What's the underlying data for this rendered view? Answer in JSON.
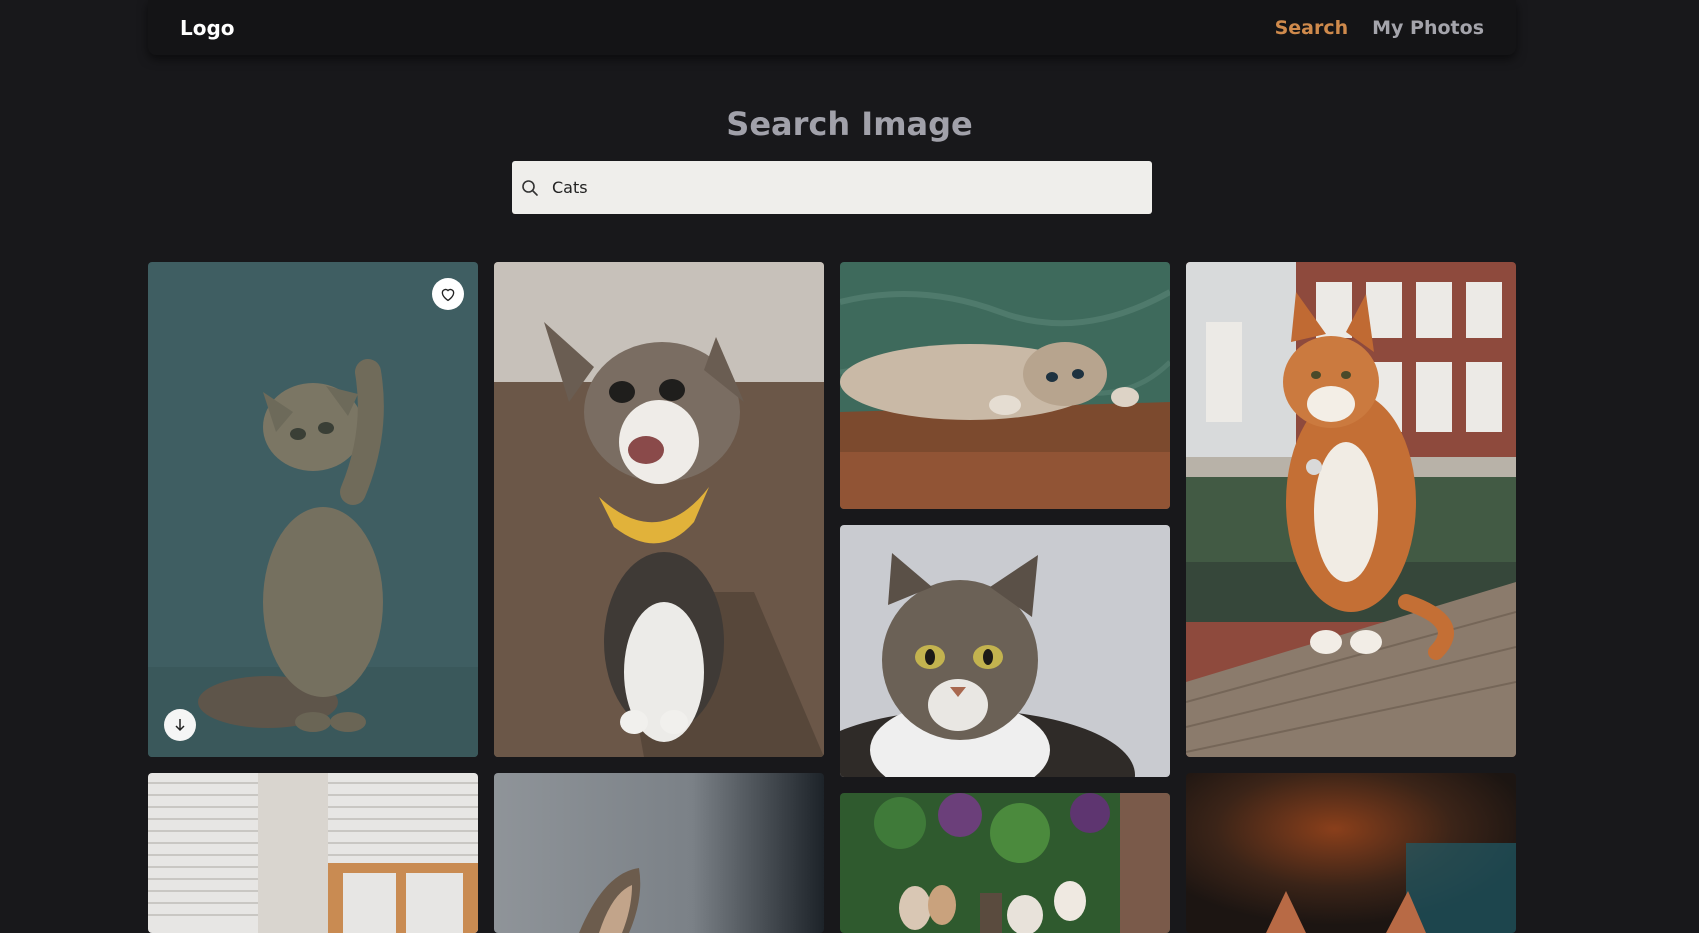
{
  "header": {
    "logo": "Logo",
    "nav": [
      {
        "label": "Search",
        "active": true
      },
      {
        "label": "My Photos",
        "active": false
      }
    ]
  },
  "main": {
    "title": "Search Image",
    "search": {
      "value": "Cats",
      "icon": "search-icon"
    }
  },
  "gallery": {
    "cards": [
      {
        "subject": "kitten reaching up",
        "favorite_icon": "heart-icon",
        "download_icon": "arrow-down-icon"
      },
      {
        "subject": "smiling cat with yellow bandana"
      },
      {
        "subject": "cat lying on wooden floor"
      },
      {
        "subject": "tabby cat portrait"
      },
      {
        "subject": "orange cat sitting by canal"
      },
      {
        "subject": "window with blinds"
      },
      {
        "subject": "cat ear on grey background"
      },
      {
        "subject": "kittens in garden"
      },
      {
        "subject": "cat on blurred orange background"
      }
    ]
  },
  "colors": {
    "background": "#18181b",
    "navbar": "#141416",
    "accent": "#cf8a4c",
    "nav_inactive": "#a4a4ab",
    "search_bg": "#efeeeb"
  }
}
